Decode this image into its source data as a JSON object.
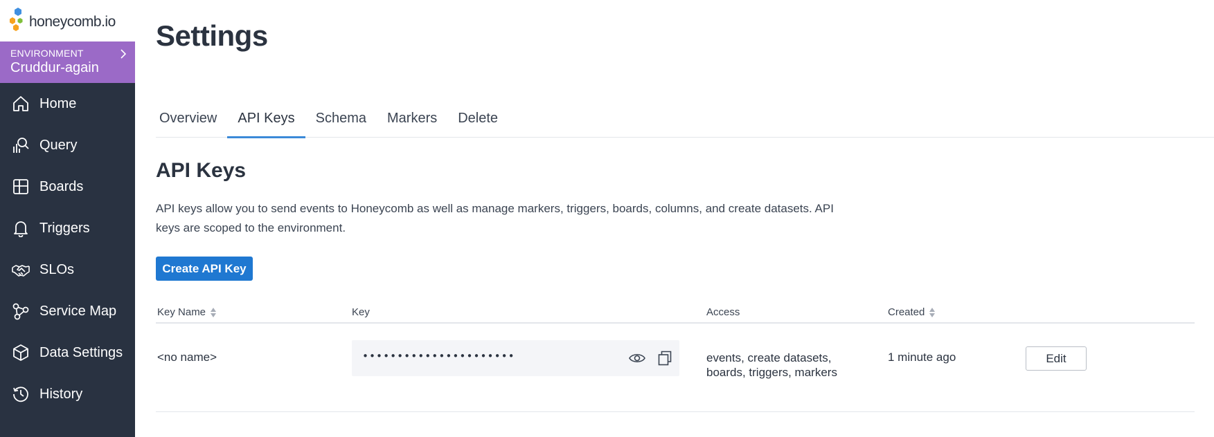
{
  "brand": {
    "logo_text": "honeycomb.io",
    "colors": {
      "sidebar": "#293241",
      "environment": "#9b6ac7",
      "accent": "#1f78d1",
      "tab_underline": "#3b8ad8"
    }
  },
  "environment": {
    "label": "ENVIRONMENT",
    "name": "Cruddur-again"
  },
  "sidebar": {
    "items": [
      {
        "label": "Home",
        "icon": "home-icon"
      },
      {
        "label": "Query",
        "icon": "query-icon"
      },
      {
        "label": "Boards",
        "icon": "boards-icon"
      },
      {
        "label": "Triggers",
        "icon": "bell-icon"
      },
      {
        "label": "SLOs",
        "icon": "handshake-icon"
      },
      {
        "label": "Service Map",
        "icon": "service-map-icon"
      },
      {
        "label": "Data Settings",
        "icon": "cube-icon"
      },
      {
        "label": "History",
        "icon": "history-icon"
      }
    ]
  },
  "page": {
    "title": "Settings",
    "tabs": [
      {
        "label": "Overview",
        "active": false
      },
      {
        "label": "API Keys",
        "active": true
      },
      {
        "label": "Schema",
        "active": false
      },
      {
        "label": "Markers",
        "active": false
      },
      {
        "label": "Delete",
        "active": false
      }
    ]
  },
  "api_keys": {
    "title": "API Keys",
    "description": "API keys allow you to send events to Honeycomb as well as manage markers, triggers, boards, columns, and create datasets. API keys are scoped to the environment.",
    "create_button": "Create API Key",
    "columns": {
      "key_name": "Key Name",
      "key": "Key",
      "access": "Access",
      "created": "Created"
    },
    "rows": [
      {
        "name": "<no name>",
        "key_masked": "••••••••••••••••••••••",
        "access": "events, create datasets, boards, triggers, markers",
        "created": "1 minute ago",
        "edit_label": "Edit"
      }
    ]
  }
}
